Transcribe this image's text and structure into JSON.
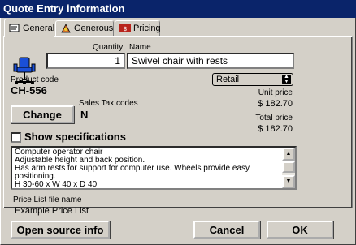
{
  "window": {
    "title": "Quote Entry information"
  },
  "tabs": [
    {
      "label": "General",
      "icon": "general-tab-icon"
    },
    {
      "label": "Generous",
      "icon": "generous-tab-icon"
    },
    {
      "label": "Pricing",
      "icon": "pricing-tab-icon"
    }
  ],
  "product": {
    "icon": "chair-icon",
    "quantity_label": "Quantity",
    "quantity": "1",
    "name_label": "Name",
    "name": "Swivel chair with rests",
    "code_label": "Product code",
    "code": "CH-556"
  },
  "pricing": {
    "price_list_selected": "Retail",
    "unit_price_label": "Unit price",
    "unit_price": "$ 182.70",
    "total_price_label": "Total price",
    "total_price": "$ 182.70"
  },
  "tax": {
    "change_label": "Change",
    "codes_label": "Sales Tax codes",
    "code": "N"
  },
  "specifications": {
    "checkbox_label": "Show specifications",
    "checked": false,
    "lines": [
      "Computer operator chair",
      "Adjustable height and back position.",
      "Has arm rests for support for computer use. Wheels provide easy positioning.",
      "H 30-60 x W 40 x D 40"
    ]
  },
  "price_list": {
    "file_label": "Price List file name",
    "file_name": "Example Price List"
  },
  "buttons": {
    "open_source": "Open source info",
    "cancel": "Cancel",
    "ok": "OK"
  },
  "colors": {
    "titlebar": "#0a246a",
    "face": "#d4d0c8",
    "chair_blue": "#1a4fd8",
    "pricing_red": "#b8241c"
  }
}
